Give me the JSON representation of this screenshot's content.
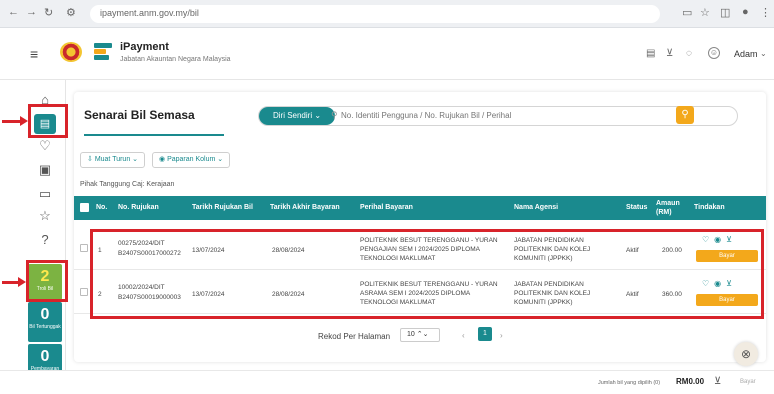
{
  "browser": {
    "url": "ipayment.anm.gov.my/bil",
    "nav_icons": [
      "back-icon",
      "forward-icon",
      "reload-icon",
      "site-info-icon"
    ],
    "right_icons": [
      "install-icon",
      "star-icon",
      "extensions-icon",
      "profile-icon",
      "menu-icon"
    ]
  },
  "header": {
    "app_title": "iPayment",
    "app_subtitle": "Jabatan Akauntan Negara Malaysia",
    "user_name": "Adam",
    "icons": [
      "document-icon",
      "cart-icon",
      "bell-icon",
      "user-icon",
      "chevron-down-icon"
    ]
  },
  "sidebar": {
    "icons": [
      "home-icon",
      "bill-icon",
      "favourite-icon",
      "receipt-icon",
      "chat-icon",
      "star-icon",
      "help-icon"
    ],
    "badges": [
      {
        "count": "2",
        "label": "Troli Bil",
        "color": "#7cb342"
      },
      {
        "count": "0",
        "label": "Bil Tertunggak",
        "color": "#1a8a8e"
      },
      {
        "count": "0",
        "label": "Pembayaran Tertunda",
        "color": "#1a8a8e"
      }
    ]
  },
  "main": {
    "title": "Senarai Bil Semasa",
    "search": {
      "selector": "Diri Sendiri",
      "placeholder": "No. Identiti Pengguna / No. Rujukan Bil / Perihal"
    },
    "toolbar": {
      "download": "Muat Turun",
      "columns": "Paparan Kolum"
    },
    "payer_label": "Pihak Tanggung Caj: Kerajaan",
    "table": {
      "headers": [
        "No.",
        "No. Rujukan",
        "Tarikh Rujukan Bil",
        "Tarikh Akhir Bayaran",
        "Perihal Bayaran",
        "Nama Agensi",
        "Status",
        "Amaun (RM)",
        "Tindakan"
      ],
      "rows": [
        {
          "no": "1",
          "ref1": "00275/2024/DIT",
          "ref2": "B2407S00017000272",
          "ref_date": "13/07/2024",
          "due_date": "28/08/2024",
          "desc1": "POLITEKNIK BESUT TERENGGANU - YURAN",
          "desc2": "PENGAJIAN SEM I 2024/2025 DIPLOMA",
          "desc3": "TEKNOLOGI MAKLUMAT",
          "agency1": "JABATAN PENDIDIKAN",
          "agency2": "POLITEKNIK DAN KOLEJ",
          "agency3": "KOMUNITI (JPPKK)",
          "status": "Aktif",
          "amount": "200.00",
          "action": "Bayar"
        },
        {
          "no": "2",
          "ref1": "10002/2024/DIT",
          "ref2": "B2407S00019000003",
          "ref_date": "13/07/2024",
          "due_date": "28/08/2024",
          "desc1": "POLITEKNIK BESUT TERENGGANU - YURAN",
          "desc2": "ASRAMA SEM I 2024/2025 DIPLOMA",
          "desc3": "TEKNOLOGI MAKLUMAT",
          "agency1": "JABATAN PENDIDIKAN",
          "agency2": "POLITEKNIK DAN KOLEJ",
          "agency3": "KOMUNITI (JPPKK)",
          "status": "Aktif",
          "amount": "360.00",
          "action": "Bayar"
        }
      ]
    },
    "pagination": {
      "label": "Rekod Per Halaman",
      "per_page": "10",
      "current_page": "1"
    }
  },
  "footer": {
    "selected_label": "Jumlah bil yang dipilih (0)",
    "total": "RM0.00",
    "pay_label": "Bayar"
  },
  "colors": {
    "teal": "#1a8a8e",
    "orange": "#f3a81b",
    "highlight_red": "#d8232a",
    "troli_green": "#7cb342"
  }
}
